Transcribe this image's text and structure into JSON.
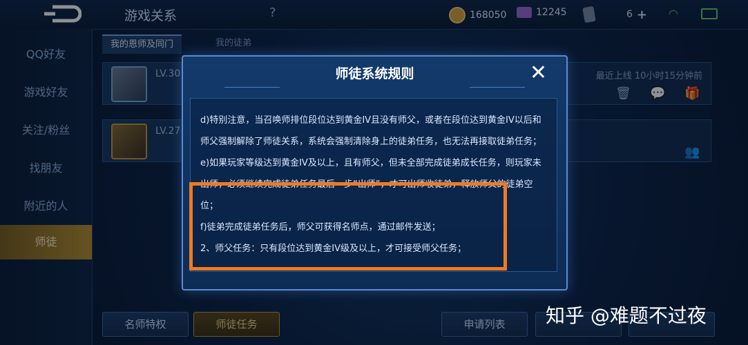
{
  "topbar": {
    "title": "游戏关系",
    "help": "?",
    "coins": "168050",
    "gems": "12245",
    "cards": "6"
  },
  "sidebar": {
    "items": [
      {
        "label": "QQ好友"
      },
      {
        "label": "游戏好友"
      },
      {
        "label": "关注/粉丝"
      },
      {
        "label": "找朋友"
      },
      {
        "label": "附近的人"
      },
      {
        "label": "师徒"
      }
    ]
  },
  "tabs": [
    {
      "label": "我的恩师及同门"
    },
    {
      "label": "我的徒弟"
    }
  ],
  "rows": [
    {
      "level": "LV.30",
      "status": "最近上线  10小时15分钟前"
    },
    {
      "level": "LV.27",
      "status": ""
    }
  ],
  "bottom_buttons": {
    "privilege": "名师特权",
    "tasks": "师徒任务",
    "apply_list": "申请列表"
  },
  "modal": {
    "title": "师徒系统规则",
    "close": "✕",
    "lines": [
      "d)特别注意，当召唤师排位段位达到黄金IV且没有师父，或者在段位达到黄金IV以后和",
      "师父强制解除了师徒关系，系统会强制清除身上的徒弟任务，也无法再接取徒弟任务；",
      "e)如果玩家等级达到黄金IV及以上，且有师父，但未全部完成徒弟成长任务，则玩家未",
      "出师，必须继续完成徒弟任务最后一步“出师”，才可出师收徒弟，释放师父的徒弟空",
      "位；",
      "f)徒弟完成徒弟任务后，师父可获得名师点，通过邮件发送；",
      "2、师父任务：只有段位达到黄金IV级及以上，才可接受师父任务；"
    ]
  },
  "watermark": "知乎 @难题不过夜",
  "colors": {
    "highlight": "#f07a21",
    "accent_gold": "#c39a3c"
  }
}
